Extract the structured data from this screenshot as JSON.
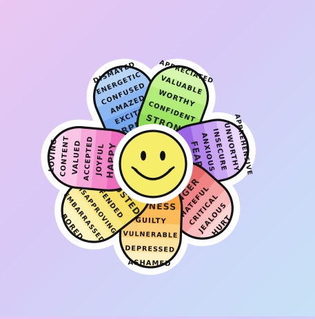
{
  "petals": [
    {
      "id": "surprised",
      "colors": [
        "#b9d7f5",
        "#a4c8f4",
        "#8ab7f1",
        "#74a7ee",
        "#5f97ea"
      ],
      "core": "SURPRISED",
      "words": [
        "DISMAYED",
        "ENERGETIC",
        "CONFUSED",
        "AMAZED",
        "EXCITED"
      ]
    },
    {
      "id": "strong",
      "colors": [
        "#d7f7b0",
        "#c5f394",
        "#b1ed78",
        "#9de462",
        "#8cdb52"
      ],
      "core": "STRONG",
      "words": [
        "APPRECIATED",
        "VALUABLE",
        "WORTHY",
        "CONFIDENT"
      ]
    },
    {
      "id": "fear",
      "colors": [
        "#ead9fa",
        "#dcc2f7",
        "#caa5f3",
        "#b486ee",
        "#9b66e6"
      ],
      "core": "FEAR",
      "words": [
        "APPREHENSIVE",
        "UNWORTHY",
        "INSECURE",
        "ANXIOUS"
      ]
    },
    {
      "id": "anger",
      "colors": [
        "#fbd5d5",
        "#f9bcbc",
        "#f5a0a0",
        "#f08484",
        "#e86a6a"
      ],
      "core": "ANGER",
      "words": [
        "HURT",
        "JEALOUS",
        "CRITICAL",
        "HATEFUL"
      ]
    },
    {
      "id": "sadness",
      "colors": [
        "#fdf0c4",
        "#fde3a0",
        "#fcd07b",
        "#fcba58",
        "#fba33c"
      ],
      "core": "SADNESS",
      "words": [
        "ASHAMED",
        "DEPRESSED",
        "VULNERABLE",
        "GUILTY"
      ]
    },
    {
      "id": "disgusted",
      "colors": [
        "#fcf5c2",
        "#faefa4",
        "#f8e884",
        "#f6e066",
        "#f3d74c"
      ],
      "core": "DISGUSTED",
      "words": [
        "BORED",
        "EMBARRASSED",
        "DISAPPROVING",
        "OFFENDED"
      ]
    },
    {
      "id": "happy",
      "colors": [
        "#fbdcef",
        "#f9c6e6",
        "#f6aad9",
        "#f38bcb",
        "#ee6dbd"
      ],
      "core": "HAPPY",
      "words": [
        "LOVING",
        "CONTENT",
        "VALUED",
        "ACCEPTED",
        "JOYFUL"
      ]
    }
  ],
  "center": {
    "icon": "smiley-face-icon",
    "color": "#f6ee6a"
  }
}
